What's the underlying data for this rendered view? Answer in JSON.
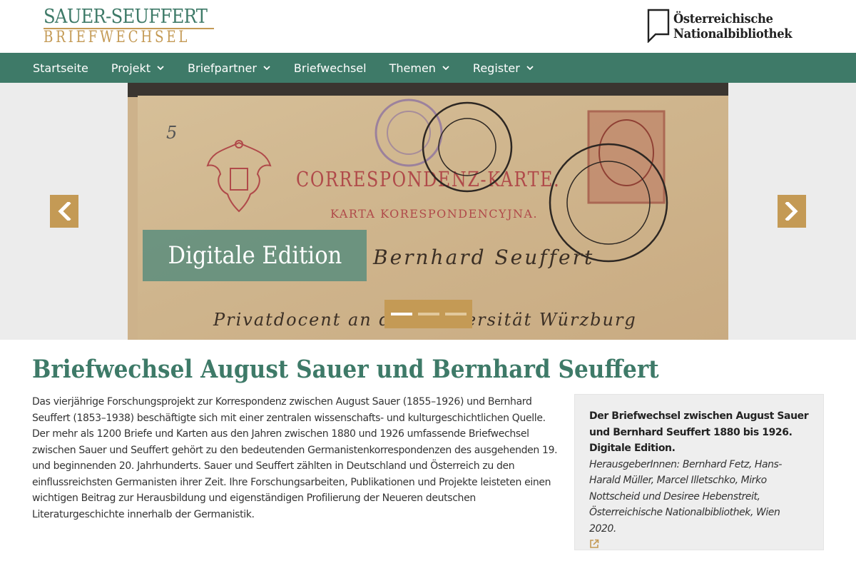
{
  "header": {
    "logo_line1": "SAUER-SEUFFERT",
    "logo_line2": "BRIEFWECHSEL",
    "partner_line1": "Österreichische",
    "partner_line2": "Nationalbibliothek"
  },
  "nav": {
    "items": [
      {
        "label": "Startseite",
        "dropdown": false
      },
      {
        "label": "Projekt",
        "dropdown": true
      },
      {
        "label": "Briefpartner",
        "dropdown": true
      },
      {
        "label": "Briefwechsel",
        "dropdown": false
      },
      {
        "label": "Themen",
        "dropdown": true
      },
      {
        "label": "Register",
        "dropdown": true
      }
    ]
  },
  "carousel": {
    "caption": "Digitale Edition",
    "slide_count": 3,
    "active_slide": 1,
    "image_text": {
      "title": "CORRESPONDENZ-KARTE.",
      "subtitle": "KARTA KORESPONDENCYJNA.",
      "handwriting_1": "Bernhard Seuffert",
      "handwriting_2": "Privatdocent an der Universität Würzburg",
      "number": "5"
    }
  },
  "main": {
    "title": "Briefwechsel August Sauer und Bernhard Seuffert",
    "intro": "Das vierjährige Forschungsprojekt zur Korrespondenz zwischen August Sauer (1855–1926) und Bernhard Seuffert (1853–1938) beschäftigte sich mit einer zentralen wissenschafts- und kulturgeschichtlichen Quelle. Der mehr als 1200 Briefe und Karten aus den Jahren zwischen 1880 und 1926 umfassende Briefwechsel zwischen Sauer und Seuffert gehört zu den bedeutenden Germanistenkorrespondenzen des ausgehenden 19. und beginnenden 20. Jahrhunderts. Sauer und Seuffert zählten in Deutschland und Österreich zu den einflussreichsten Germanisten ihrer Zeit. Ihre Forschungsarbeiten, Publikationen und Projekte leisteten einen wichtigen Beitrag zur Herausbildung und eigenständigen Profilierung der Neueren deutschen Literaturgeschichte innerhalb der Germanistik."
  },
  "infobox": {
    "title": "Der Briefwechsel zwischen August Sauer und Bernhard Seuffert 1880 bis 1926. Digitale Edition.",
    "editors": "HerausgeberInnen: Bernhard Fetz, Hans-Harald Müller, Marcel Illetschko, Mirko Nottscheid und Desiree Hebenstreit, Österreichische Nationalbibliothek, Wien 2020.",
    "link_icon": "external-link-icon"
  },
  "colors": {
    "brand_green": "#3e7a68",
    "brand_gold": "#c49a55",
    "caption_bg": "#5f8e7d",
    "infobox_bg": "#eeeeee"
  }
}
